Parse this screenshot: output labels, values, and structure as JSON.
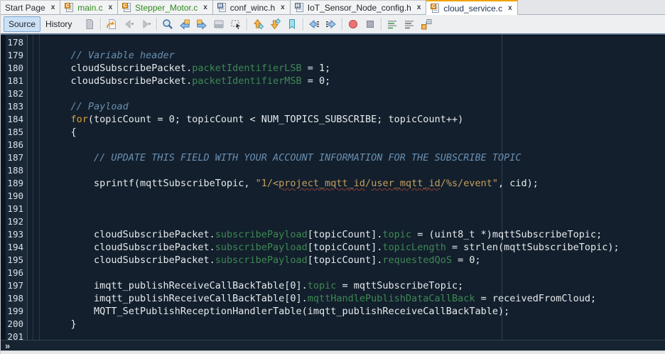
{
  "tab_bar": {
    "tabs": [
      {
        "label": "Start Page",
        "close_glyph": "x",
        "file_type": "none",
        "text_color": "#2A2E34",
        "selected": false
      },
      {
        "label": "main.c",
        "close_glyph": "x",
        "file_type": "c",
        "text_color": "#2E8A1E",
        "selected": false
      },
      {
        "label": "Stepper_Motor.c",
        "close_glyph": "x",
        "file_type": "c",
        "text_color": "#2E8A1E",
        "selected": false
      },
      {
        "label": "conf_winc.h",
        "close_glyph": "x",
        "file_type": "h",
        "text_color": "#24282E",
        "selected": false
      },
      {
        "label": "IoT_Sensor_Node_config.h",
        "close_glyph": "x",
        "file_type": "h",
        "text_color": "#24282E",
        "selected": false
      },
      {
        "label": "cloud_service.c",
        "close_glyph": "x",
        "file_type": "c",
        "text_color": "#1D3250",
        "selected": true
      }
    ]
  },
  "toolbar": {
    "source_label": "Source",
    "history_label": "History",
    "icons": [
      "last-edited-document",
      "|",
      "jump-to-last-edit",
      "back",
      "forward",
      "|",
      "find-selection",
      "find-previous",
      "find-next",
      "toggle-highlight-search",
      "rectangular-selection",
      "|",
      "previous-bookmark",
      "next-bookmark",
      "toggle-bookmark",
      "|",
      "shift-line-left",
      "shift-line-right",
      "|",
      "start-macro-recording",
      "stop-macro-recording",
      "|",
      "comment-lines",
      "uncomment-lines",
      "toggle-header-source"
    ]
  },
  "editor": {
    "first_line_number": 178,
    "last_line_number": 201,
    "lines": [
      {
        "tokens": []
      },
      {
        "tokens": [
          [
            "    ",
            "d"
          ],
          [
            "// Variable header",
            "c"
          ]
        ]
      },
      {
        "tokens": [
          [
            "    cloudSubscribePacket.",
            "d"
          ],
          [
            "packetIdentifierLSB",
            "f"
          ],
          [
            " = 1;",
            "d"
          ]
        ]
      },
      {
        "tokens": [
          [
            "    cloudSubscribePacket.",
            "d"
          ],
          [
            "packetIdentifierMSB",
            "f"
          ],
          [
            " = 0;",
            "d"
          ]
        ]
      },
      {
        "tokens": []
      },
      {
        "tokens": [
          [
            "    ",
            "d"
          ],
          [
            "// Payload",
            "c"
          ]
        ]
      },
      {
        "tokens": [
          [
            "    ",
            "d"
          ],
          [
            "for",
            "k"
          ],
          [
            "(topicCount = 0; topicCount < NUM_TOPICS_SUBSCRIBE; topicCount++)",
            "d"
          ]
        ]
      },
      {
        "tokens": [
          [
            "    {",
            "d"
          ]
        ]
      },
      {
        "tokens": []
      },
      {
        "tokens": [
          [
            "        ",
            "d"
          ],
          [
            "// UPDATE THIS FIELD WITH YOUR ACCOUNT INFORMATION FOR THE SUBSCRIBE TOPIC",
            "c"
          ]
        ]
      },
      {
        "tokens": []
      },
      {
        "tokens": [
          [
            "        sprintf(mqttSubscribeTopic, ",
            "d"
          ],
          [
            "\"1/<",
            "s"
          ],
          [
            "project_mqtt_id",
            "sw"
          ],
          [
            "/",
            "s"
          ],
          [
            "user_mqtt_id",
            "sw"
          ],
          [
            "/%s/event\"",
            "s"
          ],
          [
            ", cid);",
            "d"
          ]
        ]
      },
      {
        "tokens": []
      },
      {
        "tokens": []
      },
      {
        "tokens": []
      },
      {
        "tokens": [
          [
            "        cloudSubscribePacket.",
            "d"
          ],
          [
            "subscribePayload",
            "f"
          ],
          [
            "[topicCount].",
            "d"
          ],
          [
            "topic",
            "f"
          ],
          [
            " = (uint8_t *)mqttSubscribeTopic;",
            "d"
          ]
        ]
      },
      {
        "tokens": [
          [
            "        cloudSubscribePacket.",
            "d"
          ],
          [
            "subscribePayload",
            "f"
          ],
          [
            "[topicCount].",
            "d"
          ],
          [
            "topicLength",
            "f"
          ],
          [
            " = strlen(mqttSubscribeTopic);",
            "d"
          ]
        ]
      },
      {
        "tokens": [
          [
            "        cloudSubscribePacket.",
            "d"
          ],
          [
            "subscribePayload",
            "f"
          ],
          [
            "[topicCount].",
            "d"
          ],
          [
            "requestedQoS",
            "f"
          ],
          [
            " = 0;",
            "d"
          ]
        ]
      },
      {
        "tokens": []
      },
      {
        "tokens": [
          [
            "        imqtt_publishReceiveCallBackTable[0].",
            "d"
          ],
          [
            "topic",
            "f"
          ],
          [
            " = mqttSubscribeTopic;",
            "d"
          ]
        ]
      },
      {
        "tokens": [
          [
            "        imqtt_publishReceiveCallBackTable[0].",
            "d"
          ],
          [
            "mqttHandlePublishDataCallBack",
            "f"
          ],
          [
            " = receivedFromCloud;",
            "d"
          ]
        ]
      },
      {
        "tokens": [
          [
            "        MQTT_SetPublishReceptionHandlerTable(imqtt_publishReceiveCallBackTable);",
            "d"
          ]
        ]
      },
      {
        "tokens": [
          [
            "    }",
            "d"
          ]
        ]
      },
      {
        "tokens": []
      }
    ]
  },
  "breadcrumb": {
    "expand_glyph": "»"
  },
  "colors": {
    "selected_tab_accent": "#F0A30A",
    "modified_tab_text_green": "#2E8A1E",
    "editor_background": "#131F2D",
    "gutter_background": "#1A2836",
    "line_number_text": "#D9E0E7",
    "default_code_text": "#E6EAEC",
    "comment_text": "#6A8FB0",
    "keyword_text": "#DFA034",
    "field_text": "#3E8853",
    "string_text": "#C3A05C",
    "spellcheck_underline": "#8F3B34",
    "source_toggle_background": "#CCE0F6",
    "macro_record_red": "#EE7272"
  }
}
